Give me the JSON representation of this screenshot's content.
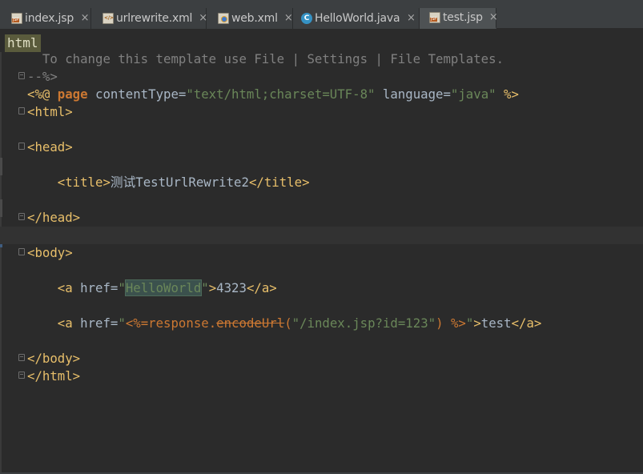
{
  "tabs": [
    {
      "label": "index.jsp",
      "icon": "jsp-file-icon",
      "active": false
    },
    {
      "label": "urlrewrite.xml",
      "icon": "xml-file-icon",
      "active": false
    },
    {
      "label": "web.xml",
      "icon": "web-xml-file-icon",
      "active": false
    },
    {
      "label": "HelloWorld.java",
      "icon": "java-class-icon",
      "active": false
    },
    {
      "label": "test.jsp",
      "icon": "jsp-file-icon",
      "active": true
    }
  ],
  "close_glyph": "×",
  "class_glyph": "C",
  "breadcrumb": "html",
  "code": {
    "l1": "  To change this template use File | Settings | File Templates.",
    "l2": "--%>",
    "l3_a": "<%@ ",
    "l3_b": "page",
    "l3_c": " contentType=",
    "l3_d": "\"text/html;charset=UTF-8\"",
    "l3_e": " language=",
    "l3_f": "\"java\"",
    "l3_g": " %>",
    "l4": "<html>",
    "l6": "<head>",
    "l8_a": "    <title>",
    "l8_b": "测试TestUrlRewrite2",
    "l8_c": "</title>",
    "l10": "</head>",
    "l12": "<body>",
    "l14_a": "    <a ",
    "l14_b": "href=",
    "l14_c": "\"",
    "l14_d": "HelloWorld",
    "l14_e": "\"",
    "l14_f": ">",
    "l14_g": "4323",
    "l14_h": "</a>",
    "l16_a": "    <a ",
    "l16_b": "href=",
    "l16_c": "\"",
    "l16_d": "<%=",
    "l16_e": "response.",
    "l16_f": "encodeUrl",
    "l16_g": "(",
    "l16_h": "\"/index.jsp?id=123\"",
    "l16_i": ") ",
    "l16_j": "%>",
    "l16_k": "\"",
    "l16_l": ">",
    "l16_m": "test",
    "l16_n": "</a>",
    "l18": "</body>",
    "l19": "</html>"
  }
}
